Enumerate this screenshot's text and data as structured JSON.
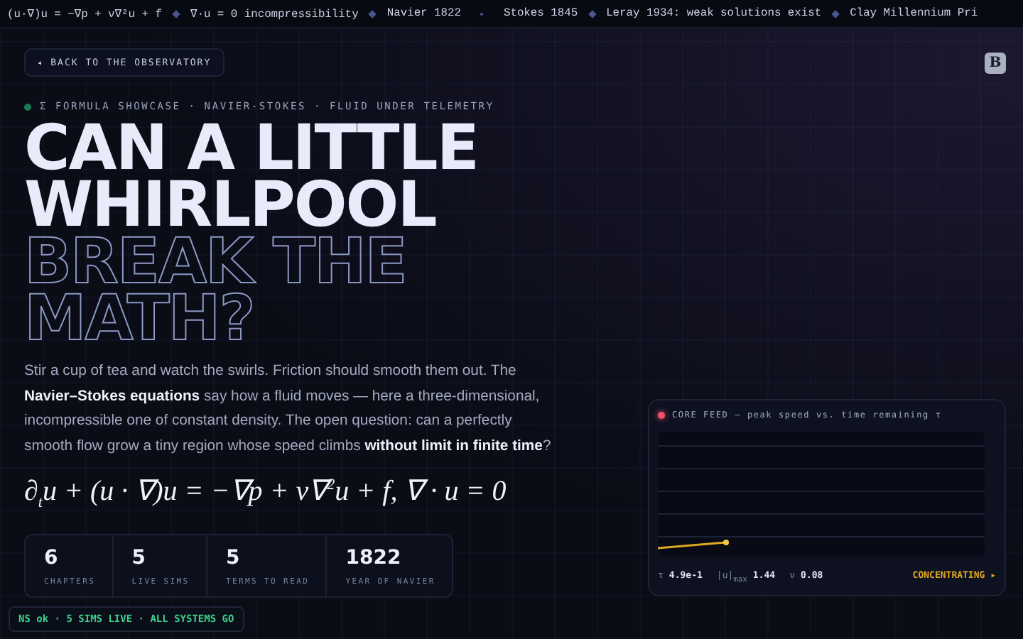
{
  "ticker": [
    {
      "text": "(u·∇)u = −∇p + ν∇²u + f",
      "kind": "diamond"
    },
    {
      "text": "∇·u = 0 incompressibility",
      "kind": "diamond"
    },
    {
      "text": "Navier 1822",
      "kind": "dot"
    },
    {
      "text": "Stokes 1845",
      "kind": "diamond"
    },
    {
      "text": "Leray 1934: weak solutions exist",
      "kind": "diamond"
    },
    {
      "text": "Clay Millennium Pri",
      "kind": "end"
    }
  ],
  "back_link": {
    "arrow": "◂",
    "label": "BACK TO THE OBSERVATORY"
  },
  "badge": "B",
  "eyebrow": "Σ FORMULA SHOWCASE · NAVIER-STOKES · FLUID UNDER TELEMETRY",
  "headline": [
    {
      "text": "CAN A LITTLE",
      "kind": "solid"
    },
    {
      "text": "WHIRLPOOL",
      "kind": "solid"
    },
    {
      "text": "BREAK THE",
      "kind": "outline"
    },
    {
      "text": "MATH?",
      "kind": "outline"
    }
  ],
  "intro": "Stir a cup of tea and watch the swirls. Friction should smooth them out. The **Navier–Stokes equations** say how a fluid moves — here a three-dimensional, incompressible one of constant density. The open question: can a perfectly smooth flow grow a tiny region whose speed climbs **without limit in finite time**?",
  "formula": "∂$_{t}$u + (u · ∇)u = −∇p + ν∇$^{2}$u + f,   ∇ · u = 0",
  "stats": [
    {
      "value": "6",
      "label": "CHAPTERS"
    },
    {
      "value": "5",
      "label": "LIVE SIMS"
    },
    {
      "value": "5",
      "label": "TERMS TO READ"
    },
    {
      "value": "1822",
      "label": "YEAR OF NAVIER"
    }
  ],
  "status_bar": "NS ok · 5 SIMS LIVE · ALL SYSTEMS GO",
  "core_feed": {
    "title": "CORE FEED — peak speed vs. time remaining τ",
    "live": true,
    "readouts": [
      {
        "label": "τ",
        "value": "4.9e-1"
      },
      {
        "label": "|u|$_{max}$",
        "value": "1.44"
      },
      {
        "label": "ν",
        "value": "0.08"
      }
    ],
    "state": "CONCENTRATING ▸"
  }
}
